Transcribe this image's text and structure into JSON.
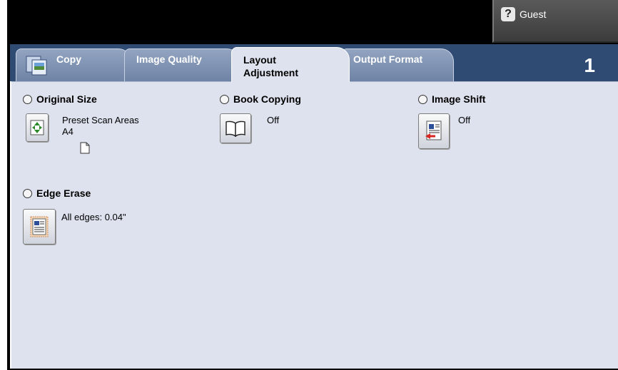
{
  "header": {
    "guest_label": "Guest"
  },
  "tabs": [
    {
      "label": "Copy",
      "icon": "copy-icon"
    },
    {
      "label": "Image Quality"
    },
    {
      "label_line1": "Layout",
      "label_line2": "Adjustment",
      "selected": true
    },
    {
      "label": "Output Format"
    }
  ],
  "job_number": "1",
  "features": {
    "original_size": {
      "title": "Original Size",
      "value_line1": "Preset Scan Areas",
      "value_line2": "A4",
      "icon": "scan-area-icon"
    },
    "book_copying": {
      "title": "Book Copying",
      "value": "Off",
      "icon": "book-icon"
    },
    "image_shift": {
      "title": "Image Shift",
      "value": "Off",
      "icon": "image-shift-icon"
    },
    "edge_erase": {
      "title": "Edge Erase",
      "value": "All edges: 0.04\"",
      "icon": "edge-erase-icon"
    }
  },
  "colors": {
    "tab_bar": "#2f4a73",
    "content_bg": "#dde2ee",
    "tab_inactive": "#7f92b2"
  }
}
